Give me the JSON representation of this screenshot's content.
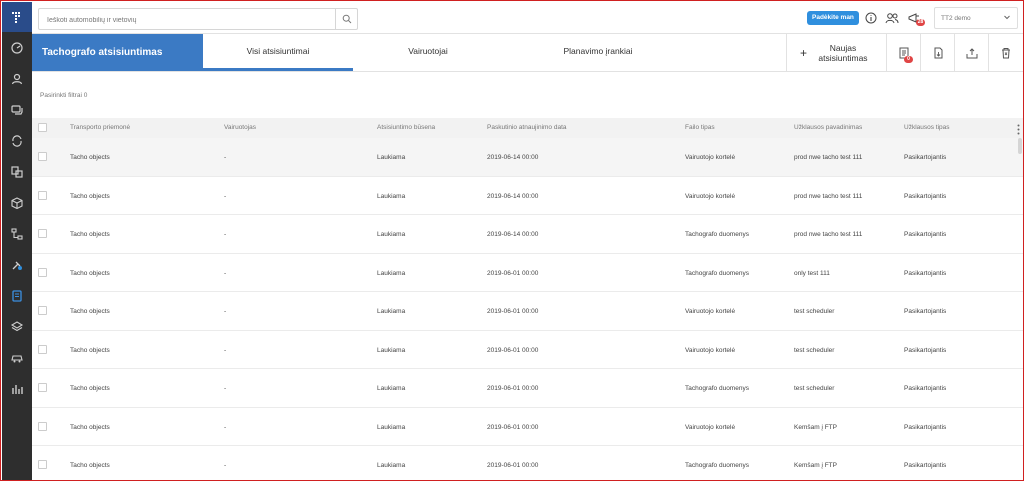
{
  "search": {
    "placeholder": "Ieškoti automobilių ir vietovių"
  },
  "topbar": {
    "help_label": "Padėkite man",
    "notifications_badge": "28",
    "user": "TT2 demo"
  },
  "header": {
    "title": "Tachografo atsisiuntimas",
    "tabs": [
      {
        "label": "Visi atsisiuntimai",
        "active": true
      },
      {
        "label": "Vairuotojai",
        "active": false
      },
      {
        "label": "Planavimo įrankiai",
        "active": false
      }
    ],
    "new_download_label": "Naujas atsisiuntimas",
    "actions_badge": "0"
  },
  "filters": {
    "label": "Pasirinkti filtrai 0"
  },
  "table": {
    "columns": [
      "Transporto priemonė",
      "Vairuotojas",
      "Atsisiuntimo būsena",
      "Paskutinio atnaujinimo data",
      "Failo tipas",
      "Užklausos pavadinimas",
      "Užklausos tipas"
    ],
    "rows": [
      [
        "Tacho objects",
        "-",
        "Laukiama",
        "2019-06-14 00:00",
        "Vairuotojo kortelė",
        "prod nwe tacho test 111",
        "Pasikartojantis"
      ],
      [
        "Tacho objects",
        "-",
        "Laukiama",
        "2019-06-14 00:00",
        "Vairuotojo kortelė",
        "prod nwe tacho test 111",
        "Pasikartojantis"
      ],
      [
        "Tacho objects",
        "-",
        "Laukiama",
        "2019-06-14 00:00",
        "Tachografo duomenys",
        "prod nwe tacho test 111",
        "Pasikartojantis"
      ],
      [
        "Tacho objects",
        "-",
        "Laukiama",
        "2019-06-01 00:00",
        "Tachografo duomenys",
        "only test 111",
        "Pasikartojantis"
      ],
      [
        "Tacho objects",
        "-",
        "Laukiama",
        "2019-06-01 00:00",
        "Vairuotojo kortelė",
        "test scheduler",
        "Pasikartojantis"
      ],
      [
        "Tacho objects",
        "-",
        "Laukiama",
        "2019-06-01 00:00",
        "Vairuotojo kortelė",
        "test scheduler",
        "Pasikartojantis"
      ],
      [
        "Tacho objects",
        "-",
        "Laukiama",
        "2019-06-01 00:00",
        "Tachografo duomenys",
        "test scheduler",
        "Pasikartojantis"
      ],
      [
        "Tacho objects",
        "-",
        "Laukiama",
        "2019-06-01 00:00",
        "Vairuotojo kortelė",
        "Kemšam į FTP",
        "Pasikartojantis"
      ],
      [
        "Tacho objects",
        "-",
        "Laukiama",
        "2019-06-01 00:00",
        "Tachografo duomenys",
        "Kemšam į FTP",
        "Pasikartojantis"
      ]
    ]
  },
  "sidebar": {
    "icons": [
      "logo-icon",
      "dashboard-icon",
      "user-icon",
      "messages-icon",
      "refresh-icon",
      "documents-icon",
      "package-icon",
      "routes-icon",
      "tools-icon",
      "tachograph-icon",
      "layers-icon",
      "vehicles-icon",
      "reports-icon"
    ],
    "active": "tachograph-icon"
  },
  "colors": {
    "accent": "#3b7ac4",
    "sidebar": "#2e2e2e",
    "badge": "#e04545",
    "help": "#2f8fde"
  }
}
